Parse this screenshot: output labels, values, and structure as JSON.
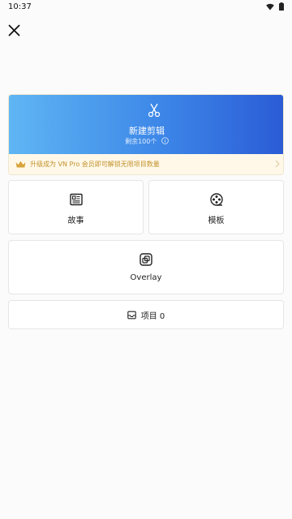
{
  "status_bar": {
    "time": "10:37",
    "wifi_icon": "wifi-icon",
    "battery_icon": "battery-icon"
  },
  "header": {
    "close_icon": "close-icon"
  },
  "hero": {
    "title": "新建剪辑",
    "subtitle": "剩余100个",
    "icon": "scissors-icon",
    "info_icon": "info-icon",
    "gradient": [
      "#5fb6f3",
      "#2b5cd6"
    ]
  },
  "promo": {
    "text": "升级成为 VN Pro 会员即可解锁无限项目数量",
    "icon": "crown-icon",
    "color": "#c2922a"
  },
  "tiles": {
    "story": {
      "label": "故事",
      "icon": "newspaper-icon"
    },
    "template": {
      "label": "模板",
      "icon": "film-reel-icon"
    },
    "overlay": {
      "label": "Overlay",
      "icon": "overlay-icon"
    }
  },
  "projects": {
    "label": "项目 0",
    "icon": "inbox-icon"
  }
}
